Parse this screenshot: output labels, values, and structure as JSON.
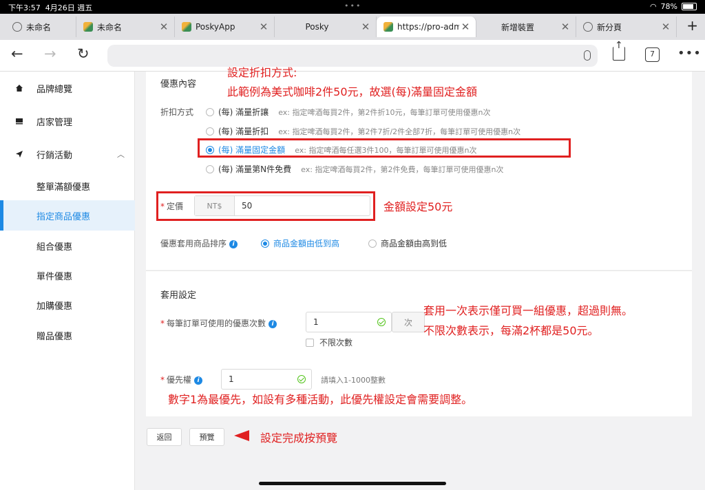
{
  "status": {
    "time": "下午3:57",
    "date": "4月26日 週五",
    "battery": "78%"
  },
  "tabs": [
    {
      "label": "未命名",
      "icon": "globe"
    },
    {
      "label": "未命名",
      "icon": "logo"
    },
    {
      "label": "PoskyApp",
      "icon": "logo"
    },
    {
      "label": "Posky",
      "icon": "none"
    },
    {
      "label": "https://pro-adm",
      "icon": "logo",
      "active": true
    },
    {
      "label": "新增裝置",
      "icon": "none"
    },
    {
      "label": "新分頁",
      "icon": "globe"
    }
  ],
  "toolbar": {
    "tab_count": "7"
  },
  "sidebar": {
    "items": [
      {
        "label": "品牌總覽",
        "icon": "home-icon"
      },
      {
        "label": "店家管理",
        "icon": "store-icon"
      },
      {
        "label": "行銷活動",
        "icon": "send-icon",
        "expanded": true
      },
      {
        "label": "整單滿額優惠"
      },
      {
        "label": "指定商品優惠",
        "active": true
      },
      {
        "label": "組合優惠"
      },
      {
        "label": "單件優惠"
      },
      {
        "label": "加購優惠"
      },
      {
        "label": "贈品優惠"
      }
    ]
  },
  "form": {
    "discount_content_title": "優惠內容",
    "discount_method_label": "折扣方式",
    "discount_options": [
      {
        "label": "(每) 滿量折讓",
        "example": "ex: 指定啤酒每買2件，第2件折10元，每筆訂單可使用優惠n次",
        "checked": false
      },
      {
        "label": "(每) 滿量折扣",
        "example": "ex: 指定啤酒每買2件，第2件7折/2件全部7折，每筆訂單可使用優惠n次",
        "checked": false
      },
      {
        "label": "(每) 滿量固定金額",
        "example": "ex: 指定啤酒每任選3件100，每筆訂單可使用優惠n次",
        "checked": true
      },
      {
        "label": "(每) 滿量第N件免費",
        "example": "ex: 指定啤酒每買2件，第2件免費，每筆訂單可使用優惠n次",
        "checked": false
      }
    ],
    "price_label": "定價",
    "price_prefix": "NT$",
    "price_value": "50",
    "sort_label": "優惠套用商品排序",
    "sort_options": [
      {
        "label": "商品金額由低到高",
        "checked": true
      },
      {
        "label": "商品金額由高到低",
        "checked": false
      }
    ],
    "apply_settings_title": "套用設定",
    "usage_label": "每筆訂單可使用的優惠次數",
    "usage_value": "1",
    "usage_suffix": "次",
    "unlimited_label": "不限次數",
    "priority_label": "優先權",
    "priority_value": "1",
    "priority_hint": "請填入1-1000整數"
  },
  "buttons": {
    "back": "返回",
    "preview": "預覽"
  },
  "annotations": {
    "discount_note_line1": "設定折扣方式:",
    "discount_note_line2": "此範例為美式咖啡2件50元，故選(每)滿量固定金額",
    "price_note": "金額設定50元",
    "usage_note_line1": "套用一次表示僅可買一組優惠，超過則無。",
    "usage_note_line2": "不限次數表示，每滿2杯都是50元。",
    "priority_note": "數字1為最優先，如設有多種活動，此優先權設定會需要調整。",
    "preview_note": "設定完成按預覽"
  },
  "colors": {
    "accent": "#1d89e4",
    "annotation": "#e02020",
    "success": "#52c41a"
  }
}
